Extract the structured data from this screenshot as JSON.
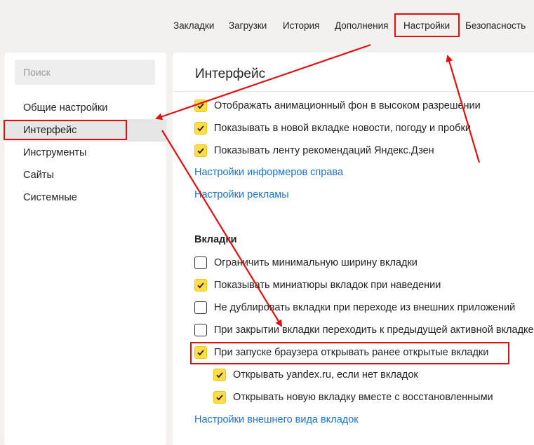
{
  "topnav": {
    "items": [
      {
        "label": "Закладки"
      },
      {
        "label": "Загрузки"
      },
      {
        "label": "История"
      },
      {
        "label": "Дополнения"
      },
      {
        "label": "Настройки",
        "active": true
      },
      {
        "label": "Безопасность"
      }
    ]
  },
  "sidebar": {
    "search_placeholder": "Поиск",
    "items": [
      {
        "label": "Общие настройки"
      },
      {
        "label": "Интерфейс",
        "active": true
      },
      {
        "label": "Инструменты"
      },
      {
        "label": "Сайты"
      },
      {
        "label": "Системные"
      }
    ]
  },
  "main": {
    "title": "Интерфейс",
    "interface_options": [
      {
        "label": "Отображать анимационный фон в высоком разрешении",
        "checked": true
      },
      {
        "label": "Показывать в новой вкладке новости, погоду и пробки",
        "checked": true
      },
      {
        "label": "Показывать ленту рекомендаций Яндекс.Дзен",
        "checked": true
      }
    ],
    "informers_link": "Настройки информеров справа",
    "ads_link": "Настройки рекламы",
    "tabs_section": {
      "heading": "Вкладки",
      "options": [
        {
          "label": "Ограничить минимальную ширину вкладки",
          "checked": false
        },
        {
          "label": "Показывать миниатюры вкладок при наведении",
          "checked": true
        },
        {
          "label": "Не дублировать вкладки при переходе из внешних приложений",
          "checked": false
        },
        {
          "label": "При закрытии вкладки переходить к предыдущей активной вкладке",
          "checked": false
        },
        {
          "label": "При запуске браузера открывать ранее открытые вкладки",
          "checked": true
        }
      ],
      "sub_options": [
        {
          "label": "Открывать yandex.ru, если нет вкладок",
          "checked": true
        },
        {
          "label": "Открывать новую вкладку вместе с восстановленными",
          "checked": true
        }
      ],
      "appearance_link": "Настройки внешнего вида вкладок"
    }
  },
  "colors": {
    "accent_checkbox": "#ffdb4d",
    "link": "#1a73c8",
    "annotation": "#e01010"
  }
}
